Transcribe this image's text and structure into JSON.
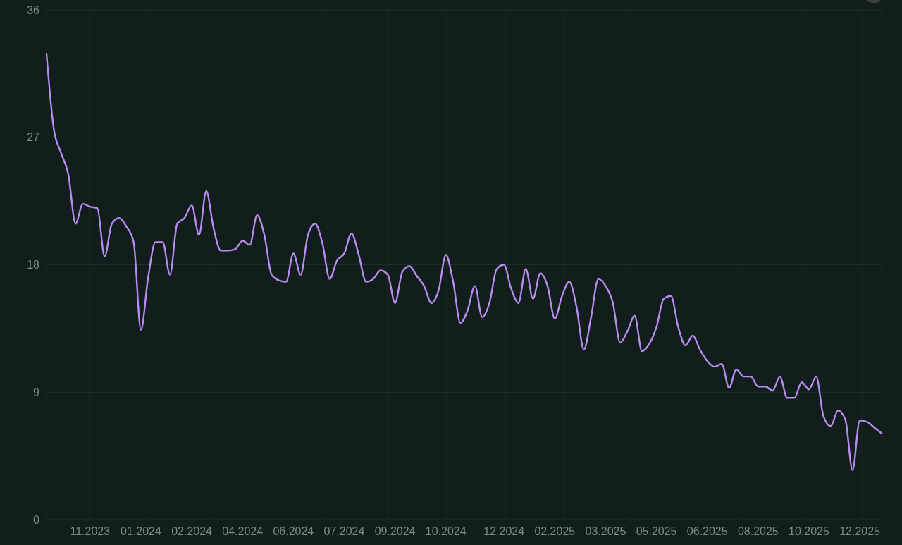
{
  "chart": {
    "chart_data": {
      "type": "line",
      "categories": [
        null,
        null,
        null,
        null,
        null,
        null,
        "11.2023",
        null,
        null,
        null,
        null,
        null,
        null,
        "01.2024",
        null,
        null,
        null,
        null,
        null,
        null,
        "02.2024",
        null,
        null,
        null,
        null,
        null,
        null,
        "04.2024",
        null,
        null,
        null,
        null,
        null,
        null,
        "06.2024",
        null,
        null,
        null,
        null,
        null,
        null,
        "07.2024",
        null,
        null,
        null,
        null,
        null,
        null,
        "09.2024",
        null,
        null,
        null,
        null,
        null,
        null,
        "10.2024",
        null,
        null,
        null,
        null,
        null,
        null,
        null,
        "12.2024",
        null,
        null,
        null,
        null,
        null,
        null,
        "02.2025",
        null,
        null,
        null,
        null,
        null,
        null,
        "03.2025",
        null,
        null,
        null,
        null,
        null,
        null,
        "05.2025",
        null,
        null,
        null,
        null,
        null,
        null,
        "06.2025",
        null,
        null,
        null,
        null,
        null,
        null,
        "08.2025",
        null,
        null,
        null,
        null,
        null,
        null,
        "10.2025",
        null,
        null,
        null,
        null,
        null,
        null,
        "12.2025",
        null,
        null,
        null
      ],
      "series": [
        {
          "color": "#b98cf2",
          "values": [
            32.9,
            27.6,
            25.9,
            24.4,
            20.9,
            22.3,
            22.1,
            22.0,
            18.6,
            20.9,
            21.3,
            20.7,
            19.6,
            13.4,
            17.1,
            19.6,
            19.6,
            17.3,
            20.9,
            21.3,
            22.2,
            20.1,
            23.2,
            20.6,
            19.0,
            19.0,
            19.1,
            19.7,
            19.4,
            21.5,
            20.1,
            17.3,
            16.9,
            16.8,
            18.8,
            17.3,
            20.1,
            20.9,
            19.5,
            17.0,
            18.3,
            18.8,
            20.2,
            18.7,
            16.8,
            17.0,
            17.6,
            17.3,
            15.3,
            17.5,
            17.9,
            17.2,
            16.5,
            15.3,
            16.2,
            18.7,
            16.8,
            13.9,
            14.8,
            16.5,
            14.3,
            15.3,
            17.7,
            18.0,
            16.3,
            15.3,
            17.7,
            15.6,
            17.4,
            16.5,
            14.2,
            15.8,
            16.8,
            15.0,
            12.0,
            14.3,
            17.0,
            16.5,
            15.3,
            12.5,
            13.3,
            14.4,
            11.9,
            12.4,
            13.6,
            15.6,
            15.8,
            13.6,
            12.3,
            13.0,
            12.0,
            11.2,
            10.8,
            11.0,
            9.3,
            10.6,
            10.1,
            10.1,
            9.4,
            9.4,
            9.1,
            10.1,
            8.6,
            8.6,
            9.7,
            9.2,
            10.1,
            7.3,
            6.6,
            7.7,
            7.1,
            3.5,
            7.0,
            6.9,
            6.5,
            6.1
          ]
        }
      ],
      "ylim": [
        0,
        36
      ],
      "yticks": [
        0,
        9,
        18,
        27,
        36
      ],
      "grid": true
    }
  }
}
